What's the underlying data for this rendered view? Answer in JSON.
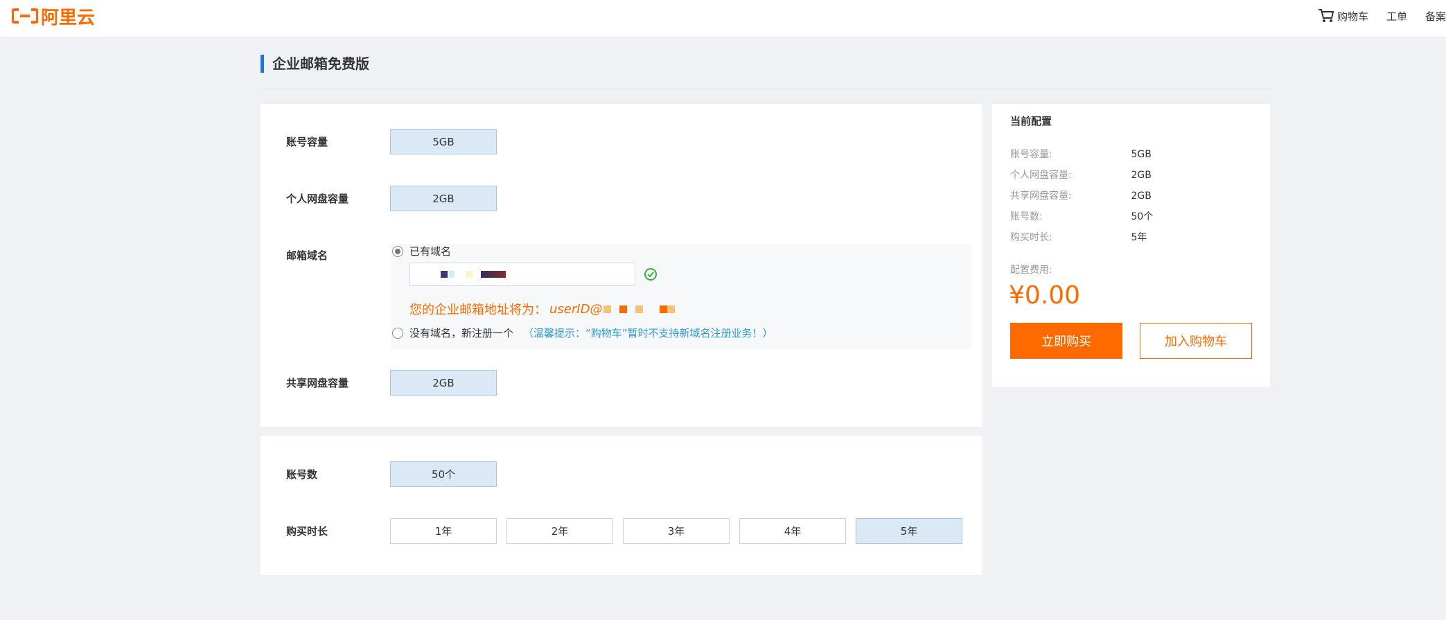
{
  "header": {
    "logo_text": "阿里云",
    "nav": {
      "cart": "购物车",
      "ticket": "工单",
      "filing": "备案"
    }
  },
  "page": {
    "title": "企业邮箱免费版"
  },
  "config": {
    "account_capacity": {
      "label": "账号容量",
      "option": "5GB"
    },
    "personal_disk": {
      "label": "个人网盘容量",
      "option": "2GB"
    },
    "mail_domain": {
      "label": "邮箱域名",
      "option_existing": "已有域名",
      "preview_prefix": "您的企业邮箱地址将为：",
      "preview_user": "userID@",
      "option_new": "没有域名，新注册一个",
      "tip": "（温馨提示：“购物车”暂时不支持新域名注册业务！）"
    },
    "shared_disk": {
      "label": "共享网盘容量",
      "option": "2GB"
    },
    "account_count": {
      "label": "账号数",
      "option": "50个"
    },
    "duration": {
      "label": "购买时长",
      "options": [
        "1年",
        "2年",
        "3年",
        "4年",
        "5年"
      ],
      "selected": "5年"
    }
  },
  "summary": {
    "title": "当前配置",
    "rows": [
      {
        "key": "账号容量:",
        "value": "5GB"
      },
      {
        "key": "个人网盘容量:",
        "value": "2GB"
      },
      {
        "key": "共享网盘容量:",
        "value": "2GB"
      },
      {
        "key": "账号数:",
        "value": "50个"
      },
      {
        "key": "购买时长:",
        "value": "5年"
      }
    ],
    "fee_label": "配置费用:",
    "fee_value": "¥0.00",
    "buy_label": "立即购买",
    "add_cart_label": "加入购物车"
  },
  "colors": {
    "brand": "#ff6a00",
    "accent_blue": "#1f74d6",
    "selected_bg": "#dbe9f6",
    "tip_blue": "#2e9ad8"
  }
}
